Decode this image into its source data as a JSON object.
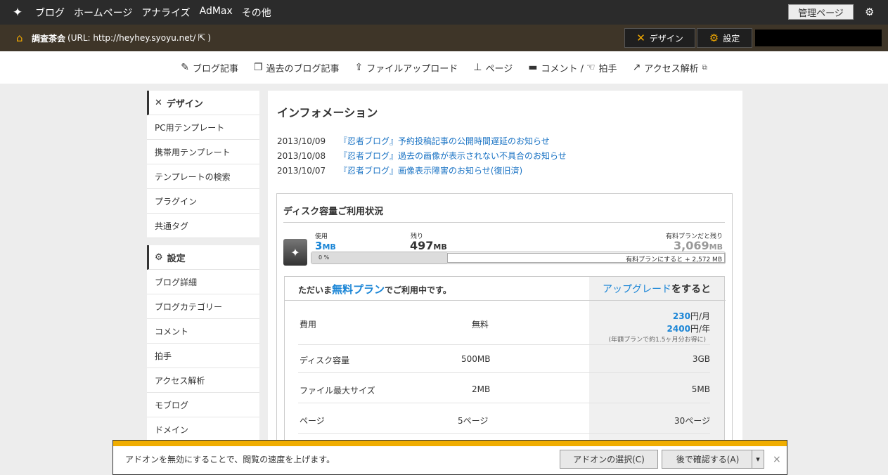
{
  "topnav": {
    "items": [
      "ブログ",
      "ホームページ",
      "アナライズ",
      "AdMax",
      "その他"
    ],
    "admin": "管理ページ"
  },
  "blogbar": {
    "title": "調査茶会",
    "url": "(URL: http://heyhey.syoyu.net/",
    "close": ")",
    "design": "デザイン",
    "settings": "設定"
  },
  "subnav": [
    {
      "icon": "edit-icon",
      "label": "ブログ記事",
      "glyph": "✎"
    },
    {
      "icon": "pages-icon",
      "label": "過去のブログ記事",
      "glyph": "❐"
    },
    {
      "icon": "upload-icon",
      "label": "ファイルアップロード",
      "glyph": "⇪"
    },
    {
      "icon": "sitemap-icon",
      "label": "ページ",
      "glyph": "⊥"
    },
    {
      "icon": "comment-icon",
      "label": "コメント /",
      "glyph": "▬"
    },
    {
      "icon": "clap-icon",
      "label": "拍手",
      "glyph": "☜"
    },
    {
      "icon": "chart-icon",
      "label": "アクセス解析",
      "glyph": "↗"
    }
  ],
  "sidebar": {
    "design": {
      "label": "デザイン",
      "items": [
        "PC用テンプレート",
        "携帯用テンプレート",
        "テンプレートの検索",
        "プラグイン",
        "共通タグ"
      ]
    },
    "settings": {
      "label": "設定",
      "items": [
        "ブログ詳細",
        "ブログカテゴリー",
        "コメント",
        "拍手",
        "アクセス解析",
        "モブログ",
        "ドメイン"
      ]
    }
  },
  "info": {
    "title": "インフォメーション",
    "news": [
      {
        "date": "2013/10/09",
        "text": "『忍者ブログ』予約投稿記事の公開時間遅延のお知らせ"
      },
      {
        "date": "2013/10/08",
        "text": "『忍者ブログ』過去の画像が表示されない不具合のお知らせ"
      },
      {
        "date": "2013/10/07",
        "text": "『忍者ブログ』画像表示障害のお知らせ(復旧済)"
      }
    ]
  },
  "disk": {
    "title": "ディスク容量ご利用状況",
    "used_label": "使用",
    "used_value": "3",
    "used_unit": "MB",
    "remaining_label": "残り",
    "remaining_value": "497",
    "remaining_unit": "MB",
    "paid_label": "有料プランだと残り",
    "paid_value": "3,069",
    "paid_unit": "MB",
    "used_fraction": 0.006,
    "bar_pct": "0 %",
    "bar_paid": "有料プランにすると + 2,572 MB"
  },
  "plan": {
    "head_pre": "ただいま",
    "head_blue": "無料プラン",
    "head_post": "でご利用中です。",
    "upg_blue": "アップグレード",
    "upg_post": "をすると",
    "rows": {
      "cost": {
        "label": "費用",
        "free": "無料",
        "paid_month_num": "230",
        "paid_month_unit": "円/月",
        "paid_year_num": "2400",
        "paid_year_unit": "円/年",
        "note": "(年額プランで約1.5ヶ月分お得に)"
      },
      "disk": {
        "label": "ディスク容量",
        "free": "500MB",
        "paid": "3GB"
      },
      "file": {
        "label": "ファイル最大サイズ",
        "free": "2MB",
        "paid": "5MB"
      },
      "page": {
        "label": "ページ",
        "free": "5ページ",
        "paid": "30ページ"
      }
    }
  },
  "notif": {
    "text": "アドオンを無効にすることで、閲覧の速度を上げます。",
    "select": "アドオンの選択(C)",
    "later": "後で確認する(A)",
    "dropdown": "▾",
    "close": "×"
  },
  "colors": {
    "accent": "#f2a900",
    "link": "#1a73c4",
    "blue": "#1a85d6"
  }
}
